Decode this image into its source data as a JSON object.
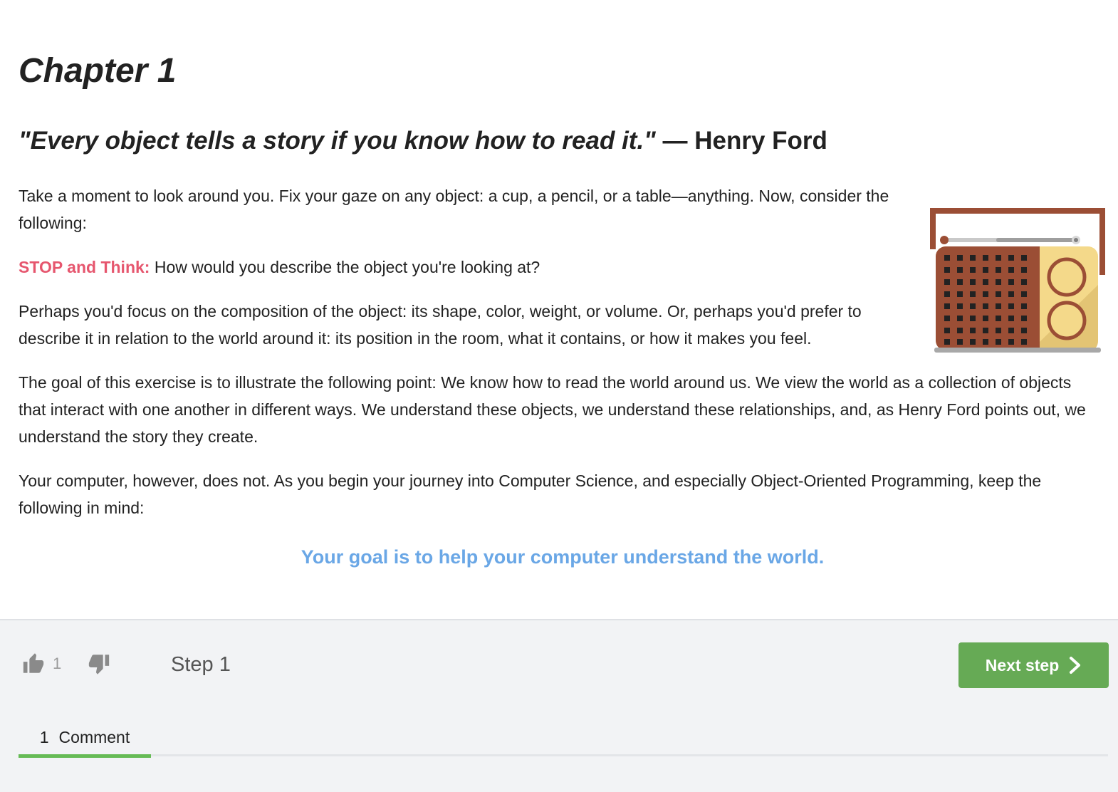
{
  "lesson": {
    "chapter_title": "Chapter 1",
    "quote_text": "\"Every object tells a story if you know how to read it.\"",
    "quote_author": " — Henry Ford",
    "paragraph_1": "Take a moment to look around you. Fix your gaze on any object: a cup, a pencil, or a table—anything. Now, consider the following:",
    "stop_label": "STOP and Think:",
    "stop_question": " How would you describe the object you're looking at?",
    "paragraph_2": "Perhaps you'd focus on the composition of the object: its shape, color, weight, or volume. Or, perhaps you'd prefer to describe it in relation to the world around it: its position in the room, what it contains, or how it makes you feel.",
    "paragraph_3": "The goal of this exercise is to illustrate the following point: We know how to read the world around us. We view the world as a collection of objects that interact with one another in different ways. We understand these objects, we understand these relationships, and, as Henry Ford points out, we understand the story they create.",
    "paragraph_4": "Your computer, however, does not. As you begin your journey into Computer Science, and especially Object-Oriented Programming, keep the following in mind:",
    "callout": "Your goal is to help your computer understand the world.",
    "illustration": "radio-illustration"
  },
  "footer": {
    "like_icon": "thumbs-up-icon",
    "like_count": "1",
    "dislike_icon": "thumbs-down-icon",
    "step_label": "Step 1",
    "next_button_label": "Next step",
    "next_icon": "chevron-right-icon",
    "comments_tab_count": "1",
    "comments_tab_label": "Comment"
  },
  "colors": {
    "stop_label": "#e6566e",
    "callout": "#6aa7e6",
    "next_button": "#66aa55",
    "tab_underline": "#66bb55",
    "footer_background": "#f2f3f5"
  }
}
